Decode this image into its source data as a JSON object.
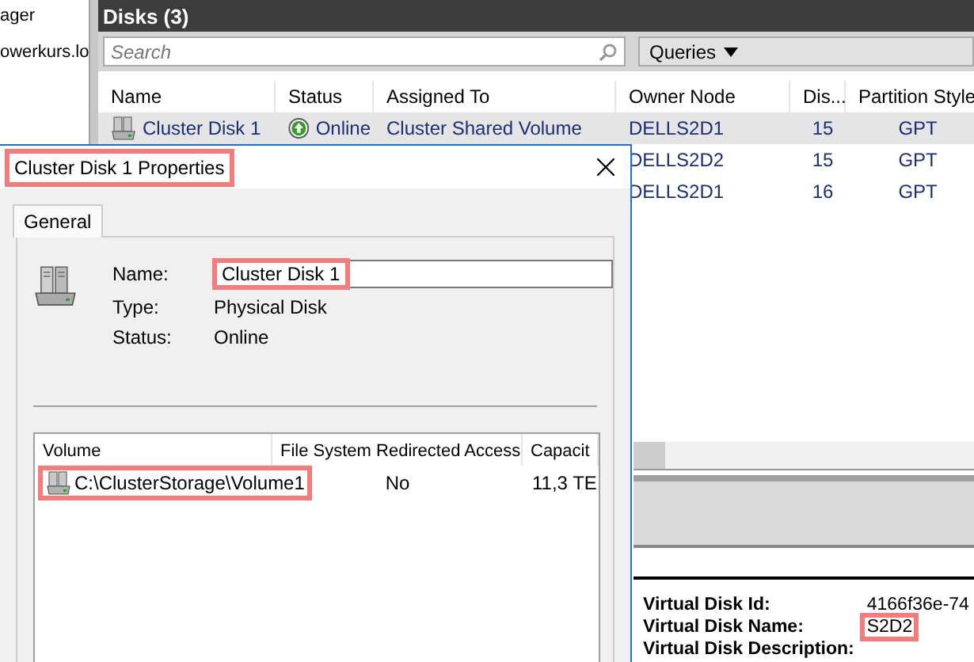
{
  "tree": {
    "items": [
      "ager",
      "owerkurs.lo"
    ]
  },
  "disks_panel": {
    "title": "Disks (3)",
    "search": {
      "placeholder": "Search"
    },
    "queries_button": "Queries",
    "columns": [
      "Name",
      "Status",
      "Assigned To",
      "Owner Node",
      "Dis...",
      "Partition Style"
    ],
    "rows": [
      {
        "selected": true,
        "name": "Cluster Disk 1",
        "status": "Online",
        "assigned_to": "Cluster Shared Volume",
        "owner_node": "DELLS2D1",
        "disks": "15",
        "partition_style": "GPT"
      },
      {
        "selected": false,
        "owner_node": "DELLS2D2",
        "disks": "15",
        "partition_style": "GPT"
      },
      {
        "selected": false,
        "owner_node": "DELLS2D1",
        "disks": "16",
        "partition_style": "GPT"
      }
    ]
  },
  "details": [
    {
      "label": "Virtual Disk Id:",
      "value": "4166f36e-74",
      "highlighted": false
    },
    {
      "label": "Virtual Disk Name:",
      "value": "S2D2",
      "highlighted": true
    },
    {
      "label": "Virtual Disk Description:"
    }
  ],
  "dialog": {
    "title": "Cluster Disk 1 Properties",
    "title_highlighted": true,
    "tabs": [
      {
        "label": "General",
        "selected": true
      }
    ],
    "fields": [
      {
        "label": "Name:",
        "value": "Cluster Disk 1",
        "kind": "input",
        "highlighted": true
      },
      {
        "label": "Type:",
        "value": "Physical Disk",
        "kind": "text",
        "highlighted": false
      },
      {
        "label": "Status:",
        "value": "Online",
        "kind": "text",
        "highlighted": false
      }
    ],
    "volumes": {
      "columns": [
        "Volume",
        "File System Redirected Access",
        "Capacit"
      ],
      "rows": [
        {
          "volume": "C:\\ClusterStorage\\Volume1",
          "redirected": "No",
          "capacity": "11,3 TE",
          "highlighted": true
        }
      ]
    }
  }
}
